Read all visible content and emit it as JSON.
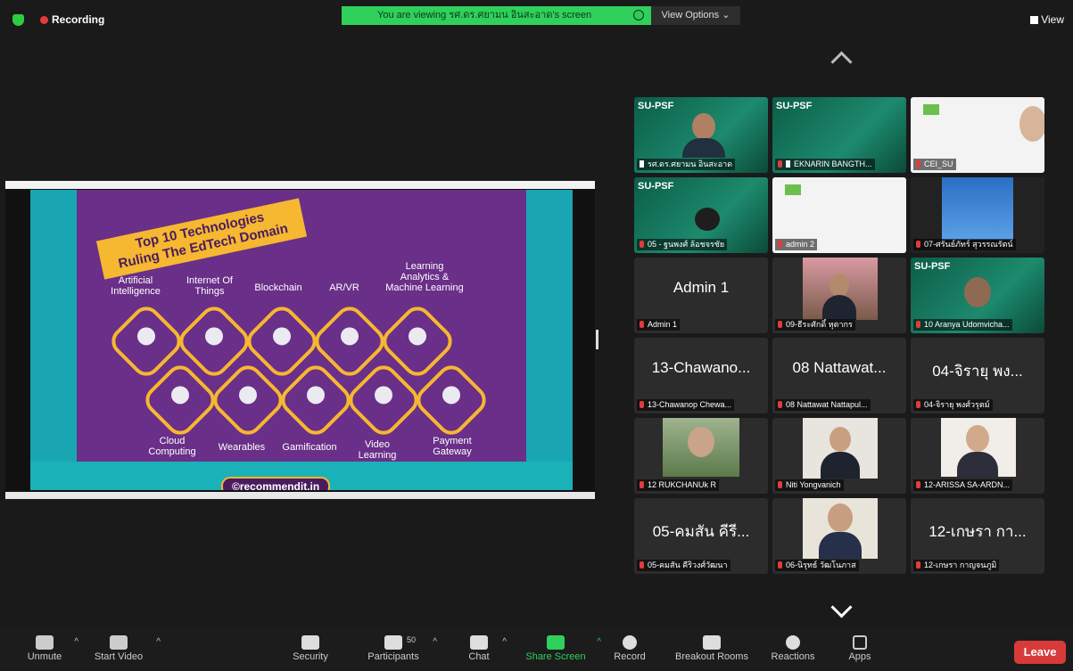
{
  "topbar": {
    "recording_label": "Recording",
    "viewing_banner": "You are viewing รศ.ดร.ศยามน อินสะอาด's screen",
    "view_options": "View Options ⌄",
    "view_label": "View"
  },
  "slide": {
    "title_line1": "Top 10 Technologies",
    "title_line2": "Ruling The EdTech Domain",
    "technologies_top": [
      "Artificial\nIntelligence",
      "Internet Of\nThings",
      "Blockchain",
      "AR/VR",
      "Learning\nAnalytics &\nMachine Learning"
    ],
    "technologies_bottom": [
      "Cloud\nComputing",
      "Wearables",
      "Gamification",
      "Video\nLearning",
      "Payment\nGateway"
    ],
    "credit": "©recommendit.in"
  },
  "participants": [
    {
      "header": "SU-PSF",
      "big": "",
      "label": "รศ.ดร.ศยามน อินสะอาด",
      "pinned": true,
      "muted": false,
      "active": true
    },
    {
      "header": "SU-PSF",
      "big": "",
      "label": "EKNARIN BANGTH...",
      "pinned": true,
      "muted": true,
      "active": false
    },
    {
      "header": "",
      "big": "",
      "label": "CEI_SU",
      "pinned": false,
      "muted": true,
      "active": false
    },
    {
      "header": "SU-PSF",
      "big": "",
      "label": "05 - ฐนพงศ์ ล้อชจรชัย",
      "pinned": false,
      "muted": true,
      "active": false
    },
    {
      "header": "",
      "big": "",
      "label": "admin 2",
      "pinned": false,
      "muted": true,
      "active": false
    },
    {
      "header": "",
      "big": "",
      "label": "07-ศรันย์ภัทร์ สุวรรณรัตน์",
      "pinned": false,
      "muted": true,
      "active": false
    },
    {
      "header": "",
      "big": "Admin 1",
      "label": "Admin 1",
      "pinned": false,
      "muted": true,
      "active": false
    },
    {
      "header": "",
      "big": "",
      "label": "09-ธีระศักดิ์ หุตากร",
      "pinned": false,
      "muted": true,
      "active": false
    },
    {
      "header": "SU-PSF",
      "big": "",
      "label": "10 Aranya Udomvicha...",
      "pinned": false,
      "muted": true,
      "active": false
    },
    {
      "header": "",
      "big": "13-Chawano...",
      "label": "13-Chawanop Chewa...",
      "pinned": false,
      "muted": true,
      "active": false
    },
    {
      "header": "",
      "big": "08 Nattawat...",
      "label": "08 Nattawat Nattapul...",
      "pinned": false,
      "muted": true,
      "active": false
    },
    {
      "header": "",
      "big": "04-จิรายุ พง...",
      "label": "04-จิรายุ พงศ์วรุตม์",
      "pinned": false,
      "muted": true,
      "active": false
    },
    {
      "header": "",
      "big": "",
      "label": "12 RUKCHANUk R",
      "pinned": false,
      "muted": true,
      "active": false
    },
    {
      "header": "",
      "big": "",
      "label": "Niti Yongvanich",
      "pinned": false,
      "muted": true,
      "active": false
    },
    {
      "header": "",
      "big": "",
      "label": "12-ARISSA SA-ARDN...",
      "pinned": false,
      "muted": true,
      "active": false
    },
    {
      "header": "",
      "big": "05-คมสัน คีรี...",
      "label": "05-คมสัน คีริวงศ์วัฒนา",
      "pinned": false,
      "muted": true,
      "active": false
    },
    {
      "header": "",
      "big": "",
      "label": "06-นิรุทธ์ วัฒโนภาส",
      "pinned": false,
      "muted": true,
      "active": false
    },
    {
      "header": "",
      "big": "12-เกษรา กา...",
      "label": "12-เกษรา กาญจนภูมิ",
      "pinned": false,
      "muted": true,
      "active": false
    }
  ],
  "toolbar": {
    "unmute": "Unmute",
    "start_video": "Start Video",
    "security": "Security",
    "participants": "Participants",
    "participant_count": "50",
    "chat": "Chat",
    "share_screen": "Share Screen",
    "record": "Record",
    "breakout_rooms": "Breakout Rooms",
    "reactions": "Reactions",
    "apps": "Apps",
    "leave": "Leave"
  },
  "colors": {
    "accent_green": "#2fd05b",
    "leave_red": "#d83a3a",
    "slide_purple": "#6a2f88",
    "slide_gold": "#f6b731",
    "slide_teal": "#19a6b2"
  }
}
